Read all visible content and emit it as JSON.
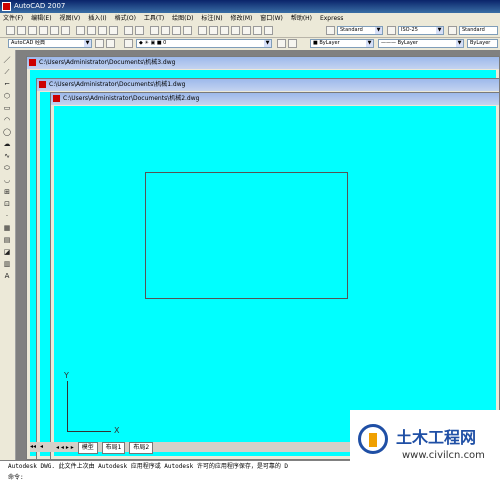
{
  "window": {
    "title": "AutoCAD 2007"
  },
  "menu": [
    "文件(F)",
    "编辑(E)",
    "视图(V)",
    "插入(I)",
    "格式(O)",
    "工具(T)",
    "绘图(D)",
    "标注(N)",
    "修改(M)",
    "窗口(W)",
    "帮助(H)",
    "Express"
  ],
  "toolbar2": {
    "workspace": "AutoCAD 经典",
    "layer": "0",
    "color": "ByLayer",
    "linetype": "ByLayer",
    "lineweight": "ByLayer"
  },
  "styles": {
    "text_style": "Standard",
    "dim_style": "ISO-25",
    "table_style": "Standard"
  },
  "documents": [
    {
      "path": "C:\\Users\\Administrator\\Documents\\机械3.dwg"
    },
    {
      "path": "C:\\Users\\Administrator\\Documents\\机械1.dwg"
    },
    {
      "path": "C:\\Users\\Administrator\\Documents\\机械2.dwg"
    }
  ],
  "ucs": {
    "x_label": "X",
    "y_label": "Y"
  },
  "layout_tabs": [
    "模型",
    "布局1",
    "布局2"
  ],
  "command_line": {
    "line1": "Autodesk DWG.  此文件上次由 Autodesk 应用程序或 Autodesk 许可的应用程序保存，是可靠的 D",
    "line2": "命令:"
  },
  "watermark": {
    "title": "土木工程网",
    "url": "www.civilcn.com"
  },
  "colors": {
    "canvas": "#00ffff",
    "ui": "#ece9d8"
  }
}
